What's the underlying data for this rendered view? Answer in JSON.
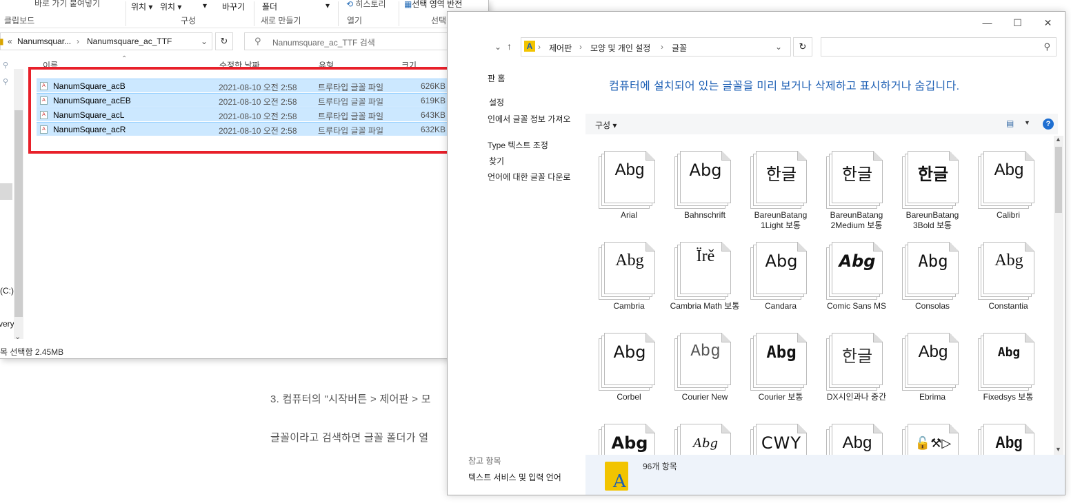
{
  "blog": {
    "line1": "3. 컴퓨터의 \"시작버튼 > 제어판 > 모",
    "line2": "글꼴이라고 검색하면 글꼴 폴더가 열"
  },
  "explorer": {
    "ribbon": {
      "quick_access": "바로 가기 붙여넣기",
      "clipboard": "클립보드",
      "move_to": "위치 ▾",
      "copy_to": "위치 ▾",
      "organize_caret": "▾",
      "rename": "바꾸기",
      "organize": "구성",
      "folder": "폴더",
      "new": "새로 만들기",
      "new_caret": "▾",
      "history": "히스토리",
      "open": "열기",
      "invert": "선택 영역 반전",
      "select": "선택"
    },
    "address": {
      "overflow": "«",
      "crumb1": "Nanumsquar...",
      "sep": "›",
      "crumb2": "Nanumsquare_ac_TTF"
    },
    "search_placeholder": "Nanumsquare_ac_TTF 검색",
    "columns": {
      "name": "이름",
      "date": "수정한 날짜",
      "type": "유형",
      "size": "크기"
    },
    "files": [
      {
        "name": "NanumSquare_acB",
        "date": "2021-08-10 오전 2:58",
        "type": "트루타입 글꼴 파일",
        "size": "626KB"
      },
      {
        "name": "NanumSquare_acEB",
        "date": "2021-08-10 오전 2:58",
        "type": "트루타입 글꼴 파일",
        "size": "619KB"
      },
      {
        "name": "NanumSquare_acL",
        "date": "2021-08-10 오전 2:58",
        "type": "트루타입 글꼴 파일",
        "size": "643KB"
      },
      {
        "name": "NanumSquare_acR",
        "date": "2021-08-10 오전 2:58",
        "type": "트루타입 글꼴 파일",
        "size": "632KB"
      }
    ],
    "nav_drive": "(C:)",
    "nav_recovery": "very",
    "status": "목 선택함 2.45MB"
  },
  "fonts_window": {
    "address": {
      "sep": "›",
      "crumb1": "제어판",
      "crumb2": "모양 및 개인 설정",
      "crumb3": "글꼴"
    },
    "sidebar": {
      "home": "판 홈",
      "settings": "설정",
      "get_info": "인에서 글꼴 정보 가져오",
      "cleartype": "Type 텍스트 조정",
      "find": "찾기",
      "download": "언어에 대한 글꼴 다운로",
      "see_also": "참고 항목",
      "text_services": "텍스트 서비스 및 입력 언어"
    },
    "heading": "컴퓨터에 설치되어 있는 글꼴을 미리 보거나 삭제하고 표시하거나 숨깁니다.",
    "organize": "구성 ▾",
    "item_count": "96개 항목",
    "fonts": [
      {
        "name": "Arial",
        "sample": "Abg"
      },
      {
        "name": "Bahnschrift",
        "sample": "Abg"
      },
      {
        "name": "BareunBatang 1Light 보통",
        "sample": "한글"
      },
      {
        "name": "BareunBatang 2Medium 보통",
        "sample": "한글"
      },
      {
        "name": "BareunBatang 3Bold 보통",
        "sample": "한글"
      },
      {
        "name": "Calibri",
        "sample": "Abg"
      },
      {
        "name": "Cambria",
        "sample": "Abg"
      },
      {
        "name": "Cambria Math 보통",
        "sample": "Ïrě"
      },
      {
        "name": "Candara",
        "sample": "Abg"
      },
      {
        "name": "Comic Sans MS",
        "sample": "Abg"
      },
      {
        "name": "Consolas",
        "sample": "Abg"
      },
      {
        "name": "Constantia",
        "sample": "Abg"
      },
      {
        "name": "Corbel",
        "sample": "Abg"
      },
      {
        "name": "Courier New",
        "sample": "Abg"
      },
      {
        "name": "Courier 보통",
        "sample": "Abg"
      },
      {
        "name": "DX시인과나 중간",
        "sample": "한글"
      },
      {
        "name": "Ebrima",
        "sample": "Abg"
      },
      {
        "name": "Fixedsys 보통",
        "sample": "Abg"
      },
      {
        "name": "",
        "sample": "Abg"
      },
      {
        "name": "",
        "sample": "Abg"
      },
      {
        "name": "",
        "sample": "CWY"
      },
      {
        "name": "",
        "sample": "Abg"
      },
      {
        "name": "",
        "sample": "🔓⚒▷"
      },
      {
        "name": "",
        "sample": "Abg"
      }
    ]
  }
}
